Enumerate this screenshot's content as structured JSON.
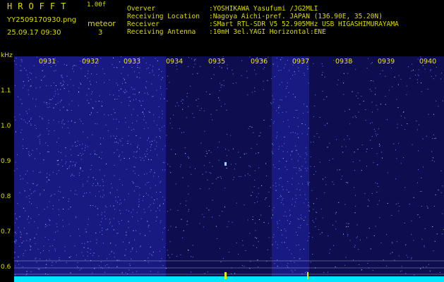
{
  "header": {
    "app_title": "HROFFT",
    "app_version": "1.00f",
    "file_name": "YY2509170930.png",
    "date_time": "25.09.17 09:30",
    "meteor_label": "meteor",
    "meteor_count": "3"
  },
  "station_info": [
    {
      "label": "Overver",
      "value": ":YOSHIKAWA Yasufumi /JG2MLI"
    },
    {
      "label": "Receiving Location",
      "value": ":Nagoya Aichi-pref. JAPAN (136.90E, 35.20N)"
    },
    {
      "label": "Receiver",
      "value": ":SMart RTL-SDR V5 52.905MHz USB HIGASHIMURAYAMA"
    },
    {
      "label": "Receiving Antenna",
      "value": ":10mH 3el.YAGI Horizontal:ENE"
    }
  ],
  "spectrogram": {
    "unit_label": "kHz",
    "y_ticks": [
      "1.1",
      "1.0",
      "0.9",
      "0.8",
      "0.7",
      "0.6"
    ],
    "x_ticks": [
      "0931",
      "0932",
      "0933",
      "0934",
      "0935",
      "0936",
      "0937",
      "0938",
      "0939",
      "0940"
    ],
    "colors": {
      "background": "#05051e",
      "noise_bright": "#2a2ad6",
      "noise_dim": "#14147a",
      "baseline": "#00e6ff",
      "marker": "#e8e800",
      "text": "#dcdc00"
    }
  }
}
